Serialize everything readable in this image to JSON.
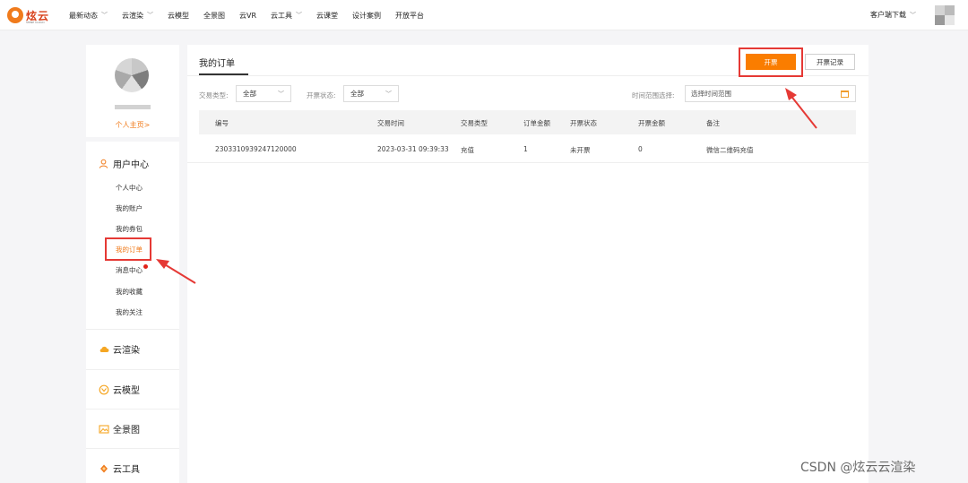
{
  "header": {
    "logo_text": "炫云",
    "logo_sub": "SHINE CLOUD",
    "nav": [
      {
        "label": "最新动态",
        "dropdown": true
      },
      {
        "label": "云渲染",
        "dropdown": true
      },
      {
        "label": "云模型",
        "dropdown": false
      },
      {
        "label": "全景图",
        "dropdown": false
      },
      {
        "label": "云VR",
        "dropdown": false
      },
      {
        "label": "云工具",
        "dropdown": true
      },
      {
        "label": "云课堂",
        "dropdown": false
      },
      {
        "label": "设计案例",
        "dropdown": false
      },
      {
        "label": "开放平台",
        "dropdown": false
      }
    ],
    "client_download": "客户端下载"
  },
  "sidebar": {
    "profile_link": "个人主页>",
    "user_center": {
      "title": "用户中心",
      "items": [
        {
          "label": "个人中心",
          "active": false,
          "dot": false
        },
        {
          "label": "我的账户",
          "active": false,
          "dot": false
        },
        {
          "label": "我的券包",
          "active": false,
          "dot": false
        },
        {
          "label": "我的订单",
          "active": true,
          "dot": false
        },
        {
          "label": "消息中心",
          "active": false,
          "dot": true
        },
        {
          "label": "我的收藏",
          "active": false,
          "dot": false
        },
        {
          "label": "我的关注",
          "active": false,
          "dot": false
        }
      ]
    },
    "sections": [
      {
        "label": "云渲染",
        "icon": "cloud-icon"
      },
      {
        "label": "云模型",
        "icon": "model-icon"
      },
      {
        "label": "全景图",
        "icon": "panorama-icon"
      },
      {
        "label": "云工具",
        "icon": "tool-icon"
      }
    ]
  },
  "main": {
    "title": "我的订单",
    "invoice_button": "开票",
    "records_button": "开票记录",
    "filters": {
      "trade_type_label": "交易类型:",
      "trade_type_value": "全部",
      "invoice_status_label": "开票状态:",
      "invoice_status_value": "全部",
      "time_range_label": "时间范围选择:",
      "time_range_placeholder": "选择时间范围"
    },
    "table": {
      "columns": [
        "编号",
        "交易时间",
        "交易类型",
        "订单金额",
        "开票状态",
        "开票金额",
        "备注"
      ],
      "rows": [
        [
          "2303310939247120000",
          "2023-03-31 09:39:33",
          "充值",
          "1",
          "未开票",
          "0",
          "微信二维码充值"
        ]
      ]
    }
  },
  "colors": {
    "accent": "#fa7d00",
    "highlight": "#e53935"
  },
  "watermark": "CSDN @炫云云渲染"
}
